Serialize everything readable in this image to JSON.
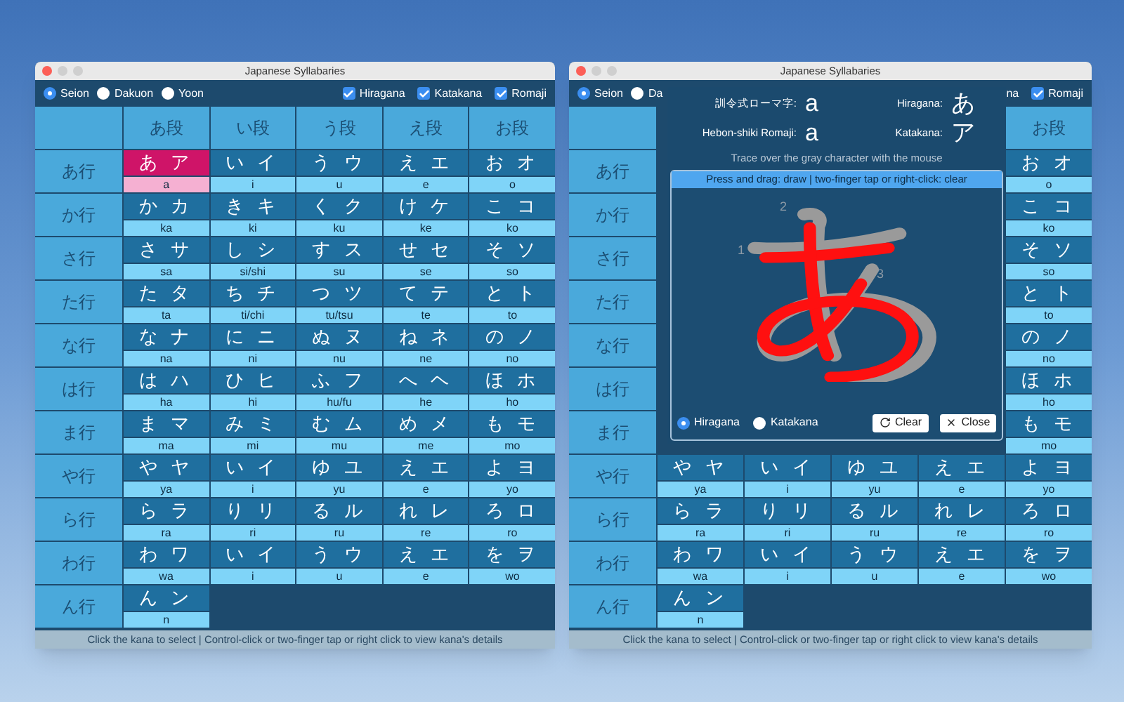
{
  "windows": [
    {
      "title": "Japanese Syllabaries",
      "modes": [
        {
          "label": "Seion",
          "selected": true
        },
        {
          "label": "Dakuon",
          "selected": false
        },
        {
          "label": "Yoon",
          "selected": false
        }
      ],
      "toggles": [
        {
          "label": "Hiragana",
          "checked": true
        },
        {
          "label": "Katakana",
          "checked": true
        },
        {
          "label": "Romaji",
          "checked": true
        }
      ],
      "table": {
        "columns": [
          "あ段",
          "い段",
          "う段",
          "え段",
          "お段"
        ],
        "rows": [
          {
            "label": "あ行",
            "cells": [
              {
                "kana": "あ ア",
                "romaji": "a",
                "selected": true
              },
              {
                "kana": "い イ",
                "romaji": "i",
                "selected": false
              },
              {
                "kana": "う ウ",
                "romaji": "u",
                "selected": false
              },
              {
                "kana": "え エ",
                "romaji": "e",
                "selected": false
              },
              {
                "kana": "お オ",
                "romaji": "o",
                "selected": false
              }
            ]
          },
          {
            "label": "か行",
            "cells": [
              {
                "kana": "か カ",
                "romaji": "ka",
                "selected": false
              },
              {
                "kana": "き キ",
                "romaji": "ki",
                "selected": false
              },
              {
                "kana": "く ク",
                "romaji": "ku",
                "selected": false
              },
              {
                "kana": "け ケ",
                "romaji": "ke",
                "selected": false
              },
              {
                "kana": "こ コ",
                "romaji": "ko",
                "selected": false
              }
            ]
          },
          {
            "label": "さ行",
            "cells": [
              {
                "kana": "さ サ",
                "romaji": "sa",
                "selected": false
              },
              {
                "kana": "し シ",
                "romaji": "si/shi",
                "selected": false
              },
              {
                "kana": "す ス",
                "romaji": "su",
                "selected": false
              },
              {
                "kana": "せ セ",
                "romaji": "se",
                "selected": false
              },
              {
                "kana": "そ ソ",
                "romaji": "so",
                "selected": false
              }
            ]
          },
          {
            "label": "た行",
            "cells": [
              {
                "kana": "た タ",
                "romaji": "ta",
                "selected": false
              },
              {
                "kana": "ち チ",
                "romaji": "ti/chi",
                "selected": false
              },
              {
                "kana": "つ ツ",
                "romaji": "tu/tsu",
                "selected": false
              },
              {
                "kana": "て テ",
                "romaji": "te",
                "selected": false
              },
              {
                "kana": "と ト",
                "romaji": "to",
                "selected": false
              }
            ]
          },
          {
            "label": "な行",
            "cells": [
              {
                "kana": "な ナ",
                "romaji": "na",
                "selected": false
              },
              {
                "kana": "に ニ",
                "romaji": "ni",
                "selected": false
              },
              {
                "kana": "ぬ ヌ",
                "romaji": "nu",
                "selected": false
              },
              {
                "kana": "ね ネ",
                "romaji": "ne",
                "selected": false
              },
              {
                "kana": "の ノ",
                "romaji": "no",
                "selected": false
              }
            ]
          },
          {
            "label": "は行",
            "cells": [
              {
                "kana": "は ハ",
                "romaji": "ha",
                "selected": false
              },
              {
                "kana": "ひ ヒ",
                "romaji": "hi",
                "selected": false
              },
              {
                "kana": "ふ フ",
                "romaji": "hu/fu",
                "selected": false
              },
              {
                "kana": "へ ヘ",
                "romaji": "he",
                "selected": false
              },
              {
                "kana": "ほ ホ",
                "romaji": "ho",
                "selected": false
              }
            ]
          },
          {
            "label": "ま行",
            "cells": [
              {
                "kana": "ま マ",
                "romaji": "ma",
                "selected": false
              },
              {
                "kana": "み ミ",
                "romaji": "mi",
                "selected": false
              },
              {
                "kana": "む ム",
                "romaji": "mu",
                "selected": false
              },
              {
                "kana": "め メ",
                "romaji": "me",
                "selected": false
              },
              {
                "kana": "も モ",
                "romaji": "mo",
                "selected": false
              }
            ]
          },
          {
            "label": "や行",
            "cells": [
              {
                "kana": "や ヤ",
                "romaji": "ya",
                "selected": false
              },
              {
                "kana": "い イ",
                "romaji": "i",
                "selected": false
              },
              {
                "kana": "ゆ ユ",
                "romaji": "yu",
                "selected": false
              },
              {
                "kana": "え エ",
                "romaji": "e",
                "selected": false
              },
              {
                "kana": "よ ヨ",
                "romaji": "yo",
                "selected": false
              }
            ]
          },
          {
            "label": "ら行",
            "cells": [
              {
                "kana": "ら ラ",
                "romaji": "ra",
                "selected": false
              },
              {
                "kana": "り リ",
                "romaji": "ri",
                "selected": false
              },
              {
                "kana": "る ル",
                "romaji": "ru",
                "selected": false
              },
              {
                "kana": "れ レ",
                "romaji": "re",
                "selected": false
              },
              {
                "kana": "ろ ロ",
                "romaji": "ro",
                "selected": false
              }
            ]
          },
          {
            "label": "わ行",
            "cells": [
              {
                "kana": "わ ワ",
                "romaji": "wa",
                "selected": false
              },
              {
                "kana": "い イ",
                "romaji": "i",
                "selected": false
              },
              {
                "kana": "う ウ",
                "romaji": "u",
                "selected": false
              },
              {
                "kana": "え エ",
                "romaji": "e",
                "selected": false
              },
              {
                "kana": "を ヲ",
                "romaji": "wo",
                "selected": false
              }
            ]
          },
          {
            "label": "ん行",
            "cells": [
              {
                "kana": "ん ン",
                "romaji": "n",
                "selected": false
              }
            ]
          }
        ]
      },
      "status_bar": "Click the kana to select | Control-click or two-finger tap or right click to view kana's details"
    },
    {
      "title": "Japanese Syllabaries",
      "modes": [
        {
          "label": "Seion",
          "selected": true
        },
        {
          "label": "Da",
          "selected": false
        }
      ],
      "toggles": [
        {
          "label": "na"
        },
        {
          "label": "Romaji",
          "checked": true
        }
      ],
      "table": {
        "columns": [
          null,
          null,
          null,
          null,
          "お段"
        ],
        "rows": [
          {
            "label": "あ行",
            "cells": [
              null,
              null,
              null,
              null,
              {
                "kana": "お オ",
                "romaji": "o",
                "selected": false
              }
            ]
          },
          {
            "label": "か行",
            "cells": [
              null,
              null,
              null,
              null,
              {
                "kana": "こ コ",
                "romaji": "ko",
                "selected": false
              }
            ]
          },
          {
            "label": "さ行",
            "cells": [
              null,
              null,
              null,
              null,
              {
                "kana": "そ ソ",
                "romaji": "so",
                "selected": false
              }
            ]
          },
          {
            "label": "た行",
            "cells": [
              null,
              null,
              null,
              null,
              {
                "kana": "と ト",
                "romaji": "to",
                "selected": false
              }
            ]
          },
          {
            "label": "な行",
            "cells": [
              null,
              null,
              null,
              null,
              {
                "kana": "の ノ",
                "romaji": "no",
                "selected": false
              }
            ]
          },
          {
            "label": "は行",
            "cells": [
              null,
              null,
              null,
              null,
              {
                "kana": "ほ ホ",
                "romaji": "ho",
                "selected": false
              }
            ]
          },
          {
            "label": "ま行",
            "cells": [
              null,
              null,
              null,
              null,
              {
                "kana": "も モ",
                "romaji": "mo",
                "selected": false
              }
            ]
          },
          {
            "label": "や行",
            "cells": [
              {
                "kana": "や ヤ",
                "romaji": "ya",
                "selected": false
              },
              {
                "kana": "い イ",
                "romaji": "i",
                "selected": false
              },
              {
                "kana": "ゆ ユ",
                "romaji": "yu",
                "selected": false
              },
              {
                "kana": "え エ",
                "romaji": "e",
                "selected": false
              },
              {
                "kana": "よ ヨ",
                "romaji": "yo",
                "selected": false
              }
            ]
          },
          {
            "label": "ら行",
            "cells": [
              {
                "kana": "ら ラ",
                "romaji": "ra",
                "selected": false
              },
              {
                "kana": "り リ",
                "romaji": "ri",
                "selected": false
              },
              {
                "kana": "る ル",
                "romaji": "ru",
                "selected": false
              },
              {
                "kana": "れ レ",
                "romaji": "re",
                "selected": false
              },
              {
                "kana": "ろ ロ",
                "romaji": "ro",
                "selected": false
              }
            ]
          },
          {
            "label": "わ行",
            "cells": [
              {
                "kana": "わ ワ",
                "romaji": "wa",
                "selected": false
              },
              {
                "kana": "い イ",
                "romaji": "i",
                "selected": false
              },
              {
                "kana": "う ウ",
                "romaji": "u",
                "selected": false
              },
              {
                "kana": "え エ",
                "romaji": "e",
                "selected": false
              },
              {
                "kana": "を ヲ",
                "romaji": "wo",
                "selected": false
              }
            ]
          },
          {
            "label": "ん行",
            "cells": [
              {
                "kana": "ん ン",
                "romaji": "n",
                "selected": false
              }
            ]
          }
        ]
      },
      "details": {
        "fields": [
          {
            "label": "訓令式ローマ字:",
            "value": "a"
          },
          {
            "label": "Hiragana:",
            "value": "あ"
          },
          {
            "label": "Hebon-shiki Romaji:",
            "value": "a"
          },
          {
            "label": "Katakana:",
            "value": "ア"
          }
        ],
        "hint": "Trace over the gray character with the mouse",
        "trace_panel": {
          "title": "Press and drag: draw | two-finger tap or right-click: clear",
          "stroke_numbers": [
            "1",
            "2",
            "3"
          ],
          "scripts": [
            {
              "label": "Hiragana",
              "selected": true
            },
            {
              "label": "Katakana",
              "selected": false
            }
          ],
          "buttons": [
            {
              "label": "Clear",
              "kind": "clear"
            },
            {
              "label": "Close",
              "kind": "close"
            }
          ]
        }
      },
      "status_bar": "Click the kana to select | Control-click or two-finger tap or right click to view kana's details"
    }
  ]
}
